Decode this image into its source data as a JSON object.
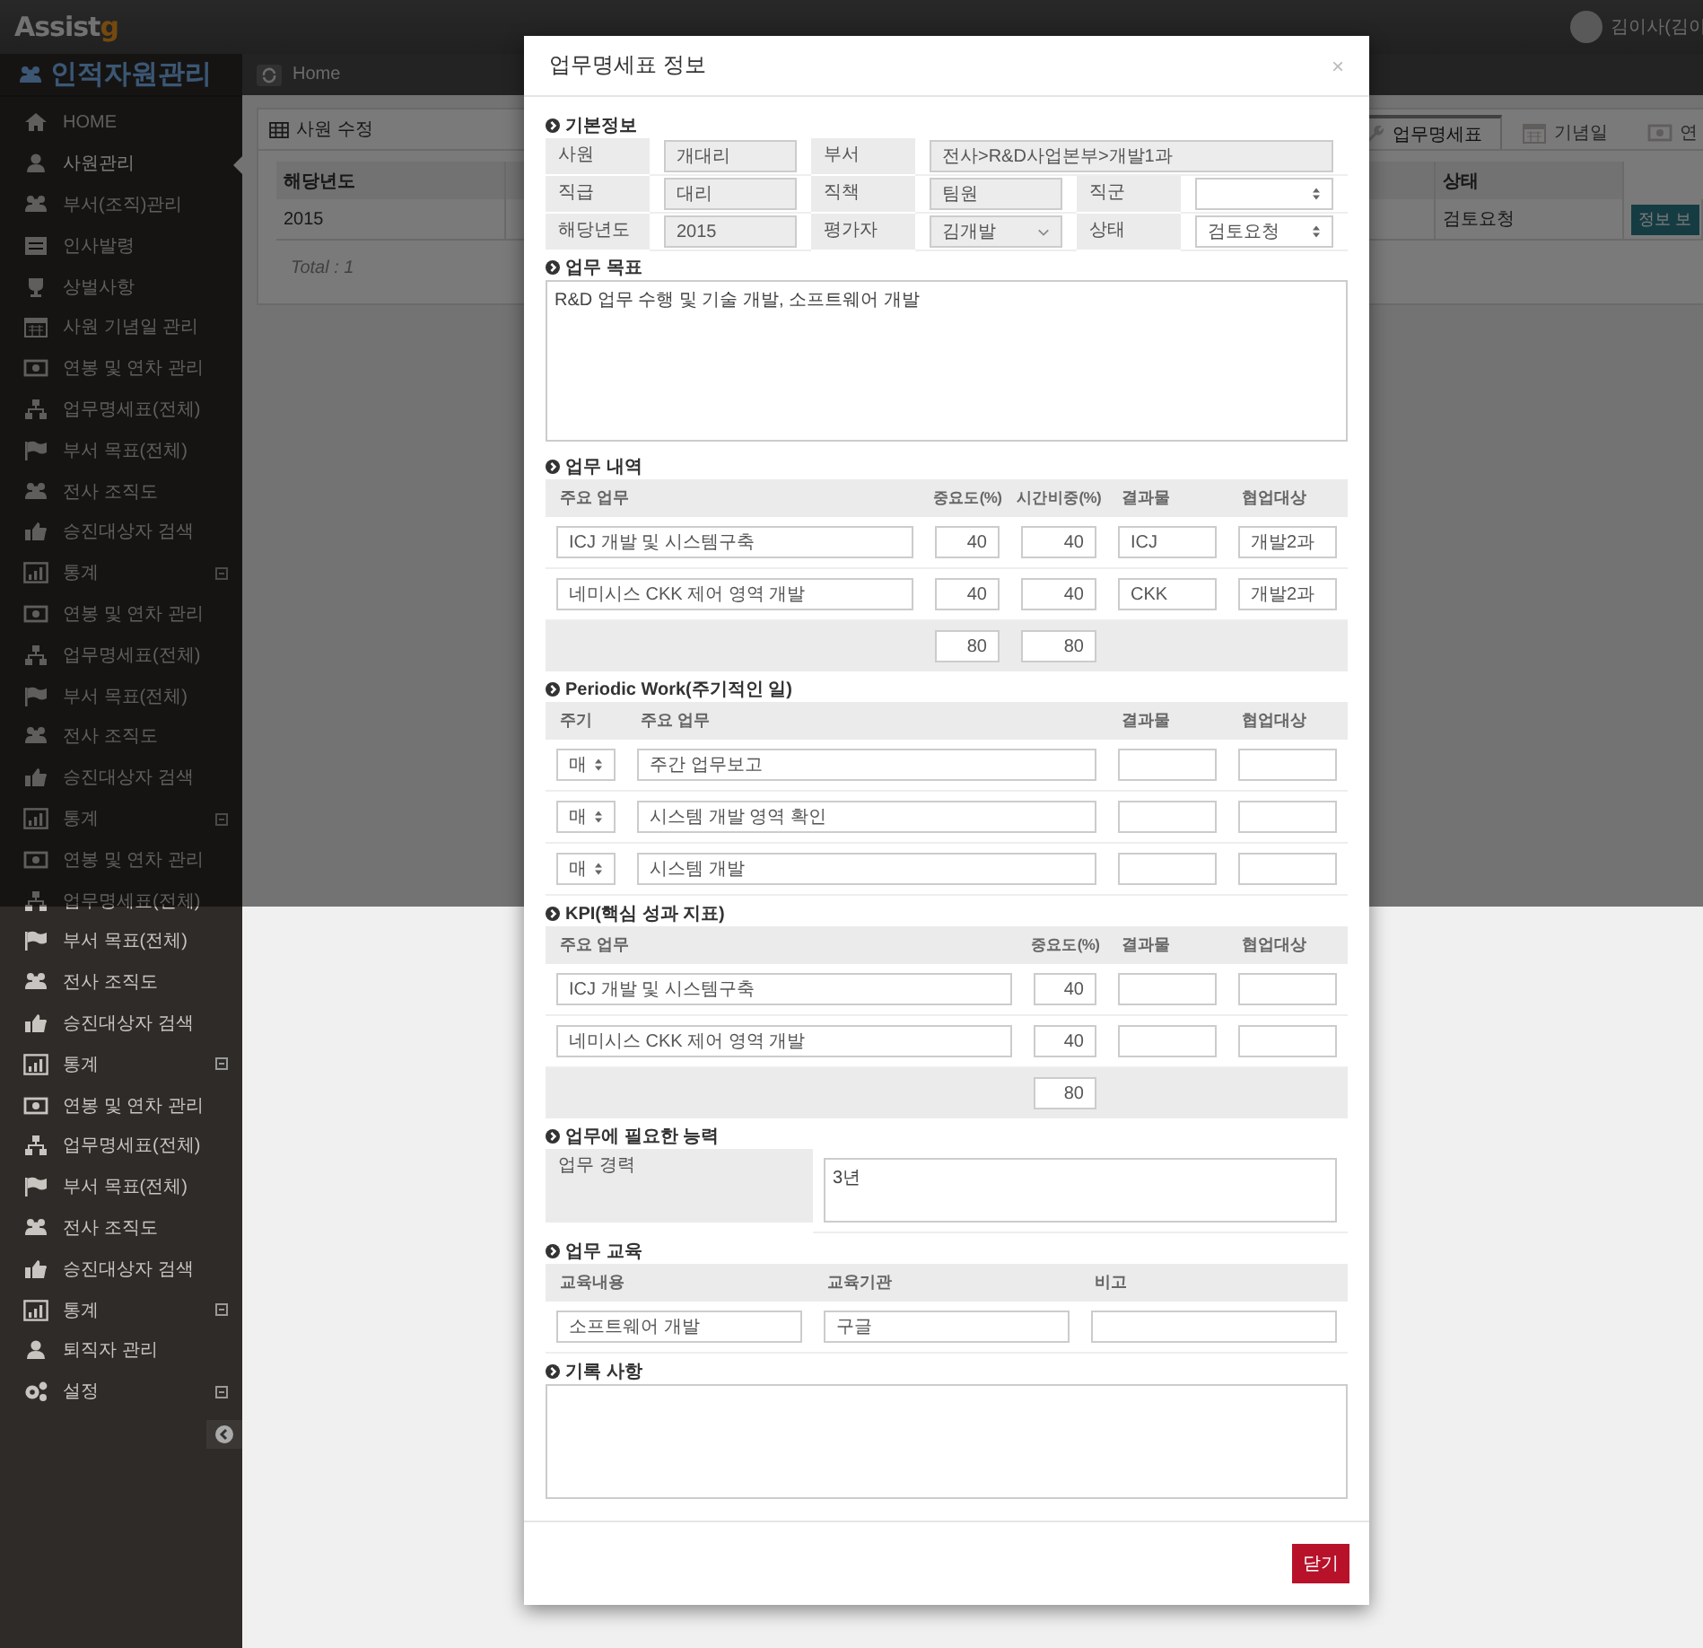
{
  "header": {
    "logo_text": "Assist",
    "logo_accent": "g",
    "user_name": "김이사(김이"
  },
  "sidebar": {
    "title": "인적자원관리",
    "items": [
      {
        "label": "HOME",
        "kind": "home",
        "selected": false,
        "toggle": false
      },
      {
        "label": "사원관리",
        "kind": "user",
        "selected": true,
        "toggle": false
      },
      {
        "label": "부서(조직)관리",
        "kind": "group",
        "selected": false,
        "toggle": false
      },
      {
        "label": "인사발령",
        "kind": "list",
        "selected": false,
        "toggle": false
      },
      {
        "label": "상벌사항",
        "kind": "trophy",
        "selected": false,
        "toggle": false
      },
      {
        "label": "사원 기념일 관리",
        "kind": "calendar",
        "selected": false,
        "toggle": false
      },
      {
        "label": "연봉 및 연차 관리",
        "kind": "money",
        "selected": false,
        "toggle": false
      },
      {
        "label": "업무명세표(전체)",
        "kind": "sitemap",
        "selected": false,
        "toggle": false
      },
      {
        "label": "부서 목표(전체)",
        "kind": "flag",
        "selected": false,
        "toggle": false
      },
      {
        "label": "전사 조직도",
        "kind": "group",
        "selected": false,
        "toggle": false
      },
      {
        "label": "승진대상자 검색",
        "kind": "thumb",
        "selected": false,
        "toggle": false
      },
      {
        "label": "통계",
        "kind": "chart",
        "selected": false,
        "toggle": true
      },
      {
        "label": "연봉 및 연차 관리",
        "kind": "money",
        "selected": false,
        "toggle": false
      },
      {
        "label": "업무명세표(전체)",
        "kind": "sitemap",
        "selected": false,
        "toggle": false
      },
      {
        "label": "부서 목표(전체)",
        "kind": "flag",
        "selected": false,
        "toggle": false
      },
      {
        "label": "전사 조직도",
        "kind": "group",
        "selected": false,
        "toggle": false
      },
      {
        "label": "승진대상자 검색",
        "kind": "thumb",
        "selected": false,
        "toggle": false
      },
      {
        "label": "통계",
        "kind": "chart",
        "selected": false,
        "toggle": true
      },
      {
        "label": "연봉 및 연차 관리",
        "kind": "money",
        "selected": false,
        "toggle": false
      },
      {
        "label": "업무명세표(전체)",
        "kind": "sitemap",
        "selected": false,
        "toggle": false
      },
      {
        "label": "부서 목표(전체)",
        "kind": "flag",
        "selected": false,
        "toggle": false
      },
      {
        "label": "전사 조직도",
        "kind": "group",
        "selected": false,
        "toggle": false
      },
      {
        "label": "승진대상자 검색",
        "kind": "thumb",
        "selected": false,
        "toggle": false
      },
      {
        "label": "통계",
        "kind": "chart",
        "selected": false,
        "toggle": true
      },
      {
        "label": "연봉 및 연차 관리",
        "kind": "money",
        "selected": false,
        "toggle": false
      },
      {
        "label": "업무명세표(전체)",
        "kind": "sitemap",
        "selected": false,
        "toggle": false
      },
      {
        "label": "부서 목표(전체)",
        "kind": "flag",
        "selected": false,
        "toggle": false
      },
      {
        "label": "전사 조직도",
        "kind": "group",
        "selected": false,
        "toggle": false
      },
      {
        "label": "승진대상자 검색",
        "kind": "thumb",
        "selected": false,
        "toggle": false
      },
      {
        "label": "통계",
        "kind": "chart",
        "selected": false,
        "toggle": true
      },
      {
        "label": "퇴직자 관리",
        "kind": "user",
        "selected": false,
        "toggle": false
      },
      {
        "label": "설정",
        "kind": "gears",
        "selected": false,
        "toggle": true
      }
    ]
  },
  "breadcrumb": {
    "label": "Home"
  },
  "panel": {
    "title": "사원 수정",
    "tabs": [
      {
        "label": "업무명세표",
        "kind": "wrench",
        "selected": true
      },
      {
        "label": "기념일",
        "kind": "calendar",
        "selected": false
      },
      {
        "label": "연",
        "kind": "money",
        "selected": false
      }
    ],
    "table": {
      "columns": [
        "해당년도",
        "상태"
      ],
      "rows": [
        {
          "cells": [
            "2015",
            "검토요청"
          ],
          "action": "정보 보"
        }
      ]
    },
    "total": "Total : 1"
  },
  "modal": {
    "title": "업무명세표 정보",
    "close": "×",
    "basic_info": {
      "heading": "기본정보",
      "rows": [
        [
          {
            "label": "사원",
            "value": "개대리",
            "kind": "text",
            "disabled": true
          },
          {
            "label": "부서",
            "value": "전사>R&D사업본부>개발1과",
            "kind": "text",
            "disabled": true
          }
        ],
        [
          {
            "label": "직급",
            "value": "대리",
            "kind": "text",
            "disabled": true
          },
          {
            "label": "직책",
            "value": "팀원",
            "kind": "text",
            "disabled": true
          },
          {
            "label": "직군",
            "kind": "select",
            "disabled": false
          }
        ],
        [
          {
            "label": "해당년도",
            "value": "2015",
            "kind": "text",
            "disabled": true
          },
          {
            "label": "평가자",
            "value": "김개발",
            "kind": "dropdown",
            "disabled": true
          },
          {
            "label": "상태",
            "value": "검토요청",
            "kind": "select",
            "disabled": false
          }
        ]
      ]
    },
    "goal": {
      "heading": "업무 목표",
      "text": "R&D 업무 수행 및 기술 개발, 소프트웨어 개발"
    },
    "tasks": {
      "heading": "업무 내역",
      "columns": [
        "주요 업무",
        "중요도(%)",
        "시간비중(%)",
        "결과물",
        "협업대상"
      ],
      "rows": [
        [
          "ICJ 개발 및 시스템구축",
          "40",
          "40",
          "ICJ",
          "개발2과"
        ],
        [
          "네미시스 CKK 제어 영역 개발",
          "40",
          "40",
          "CKK",
          "개발2과"
        ]
      ],
      "totals": [
        "80",
        "80"
      ]
    },
    "periodic": {
      "heading": "Periodic Work(주기적인 일)",
      "columns": [
        "주기",
        "주요 업무",
        "결과물",
        "협업대상"
      ],
      "rows": [
        {
          "period": "매",
          "task": "주간 업무보고"
        },
        {
          "period": "매",
          "task": "시스템 개발 영역 확인"
        },
        {
          "period": "매",
          "task": "시스템 개발"
        }
      ]
    },
    "kpi": {
      "heading": "KPI(핵심 성과 지표)",
      "columns": [
        "주요 업무",
        "중요도(%)",
        "결과물",
        "협업대상"
      ],
      "rows": [
        {
          "task": "ICJ 개발 및 시스템구축",
          "weight": "40"
        },
        {
          "task": "네미시스 CKK 제어 영역 개발",
          "weight": "40"
        }
      ],
      "total": "80"
    },
    "abilities": {
      "heading": "업무에 필요한 능력",
      "label": "업무 경력",
      "value": "3년"
    },
    "education": {
      "heading": "업무 교육",
      "columns": [
        "교육내용",
        "교육기관",
        "비고"
      ],
      "rows": [
        {
          "course": "소프트웨어 개발",
          "institution": "구글"
        }
      ]
    },
    "notes": {
      "heading": "기록 사항"
    },
    "close_button": "닫기"
  }
}
